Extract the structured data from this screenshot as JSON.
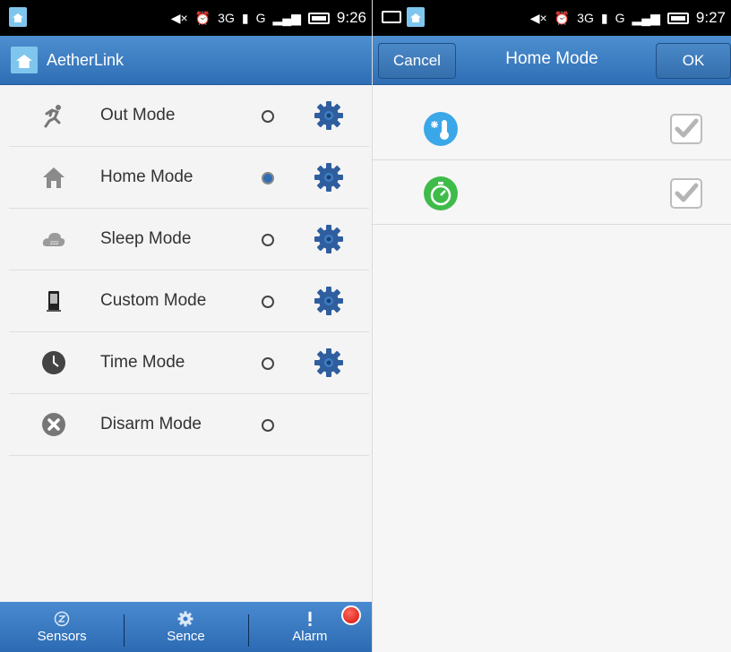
{
  "left_screen": {
    "status_bar": {
      "network_3g": "3G",
      "network_g": "G",
      "time": "9:26"
    },
    "app_bar": {
      "title": "AetherLink"
    },
    "modes": [
      {
        "label": "Out Mode",
        "icon": "running-person-icon",
        "selected": false,
        "has_settings": true
      },
      {
        "label": "Home Mode",
        "icon": "house-icon",
        "selected": true,
        "has_settings": true
      },
      {
        "label": "Sleep Mode",
        "icon": "sleep-cloud-icon",
        "selected": false,
        "has_settings": true
      },
      {
        "label": "Custom Mode",
        "icon": "phone-device-icon",
        "selected": false,
        "has_settings": true
      },
      {
        "label": "Time Mode",
        "icon": "clock-icon",
        "selected": false,
        "has_settings": true
      },
      {
        "label": "Disarm Mode",
        "icon": "close-circle-icon",
        "selected": false,
        "has_settings": false
      }
    ],
    "tabs": [
      {
        "label": "Sensors",
        "icon": "sensor-icon"
      },
      {
        "label": "Sence",
        "icon": "gear-icon"
      },
      {
        "label": "Alarm",
        "icon": "exclamation-icon"
      }
    ]
  },
  "right_screen": {
    "status_bar": {
      "network_3g": "3G",
      "network_g": "G",
      "time": "9:27"
    },
    "app_bar": {
      "cancel_label": "Cancel",
      "title": "Home Mode",
      "ok_label": "OK"
    },
    "options": [
      {
        "icon": "thermometer-snowflake-icon",
        "checked": true
      },
      {
        "icon": "stopwatch-icon",
        "checked": true
      }
    ]
  },
  "colors": {
    "accent_blue": "#2f6eb5",
    "gear_blue": "#2f5e9e",
    "alarm_red": "#d60d0d",
    "temperature_icon": "#3aa7e8",
    "timer_icon": "#3fbb4a"
  }
}
